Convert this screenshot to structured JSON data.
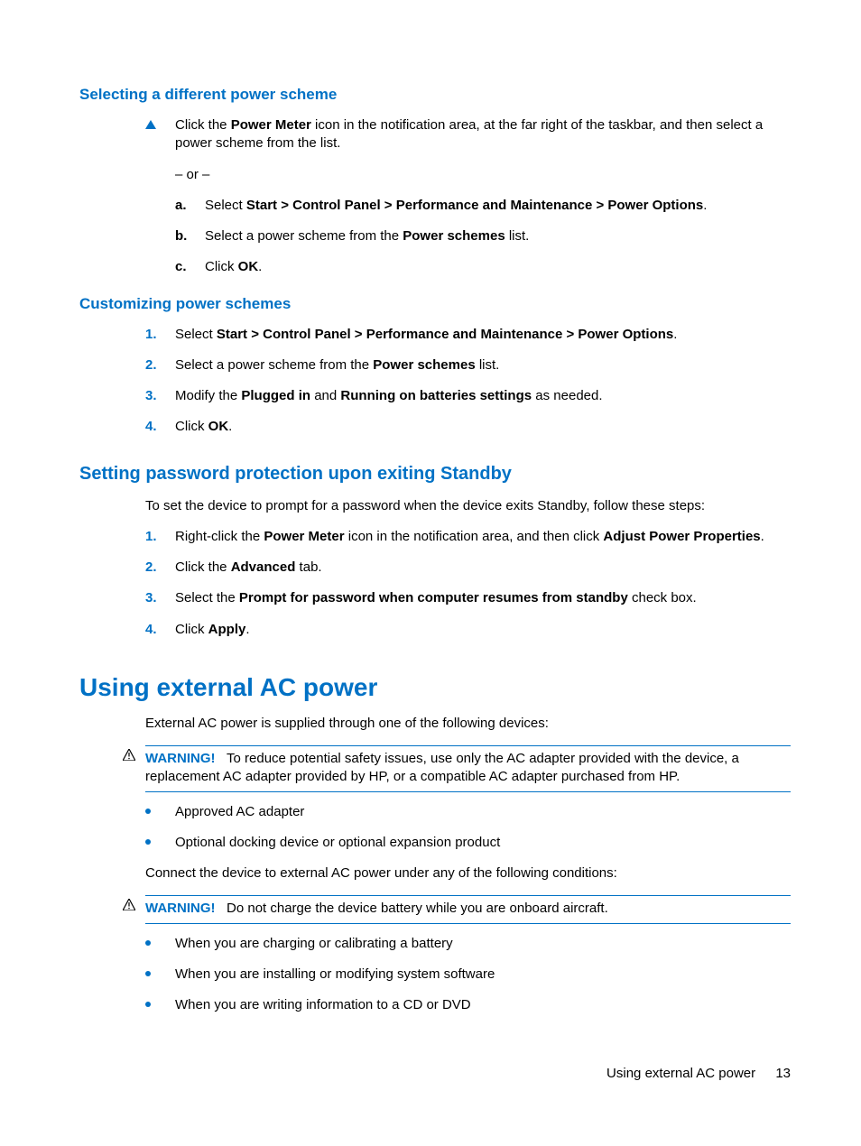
{
  "sec1": {
    "heading": "Selecting a different power scheme",
    "intro_pre": "Click the ",
    "intro_bold": "Power Meter",
    "intro_post": " icon in the notification area, at the far right of the taskbar, and then select a power scheme from the list.",
    "or": "– or –",
    "a_pre": "Select ",
    "a_bold": "Start > Control Panel > Performance and Maintenance > Power Options",
    "a_post": ".",
    "b_pre": "Select a power scheme from the ",
    "b_bold": "Power schemes",
    "b_post": " list.",
    "c_pre": "Click ",
    "c_bold": "OK",
    "c_post": "."
  },
  "sec2": {
    "heading": "Customizing power schemes",
    "s1_pre": "Select ",
    "s1_bold": "Start > Control Panel > Performance and Maintenance > Power Options",
    "s1_post": ".",
    "s2_pre": "Select a power scheme from the ",
    "s2_bold": "Power schemes",
    "s2_post": " list.",
    "s3_pre": "Modify the ",
    "s3_b1": "Plugged in",
    "s3_mid": " and ",
    "s3_b2": "Running on batteries settings",
    "s3_post": " as needed.",
    "s4_pre": "Click ",
    "s4_bold": "OK",
    "s4_post": "."
  },
  "sec3": {
    "heading": "Setting password protection upon exiting Standby",
    "intro": "To set the device to prompt for a password when the device exits Standby, follow these steps:",
    "s1_pre": "Right-click the ",
    "s1_b1": "Power Meter",
    "s1_mid": " icon in the notification area, and then click ",
    "s1_b2": "Adjust Power Properties",
    "s1_post": ".",
    "s2_pre": "Click the ",
    "s2_bold": "Advanced",
    "s2_post": " tab.",
    "s3_pre": "Select the ",
    "s3_bold": "Prompt for password when computer resumes from standby",
    "s3_post": " check box.",
    "s4_pre": "Click ",
    "s4_bold": "Apply",
    "s4_post": "."
  },
  "sec4": {
    "heading": "Using external AC power",
    "intro": "External AC power is supplied through one of the following devices:",
    "warn1_label": "WARNING!",
    "warn1_text": "To reduce potential safety issues, use only the AC adapter provided with the device, a replacement AC adapter provided by HP, or a compatible AC adapter purchased from HP.",
    "b1": "Approved AC adapter",
    "b2": "Optional docking device or optional expansion product",
    "mid": "Connect the device to external AC power under any of the following conditions:",
    "warn2_label": "WARNING!",
    "warn2_text": "Do not charge the device battery while you are onboard aircraft.",
    "c1": "When you are charging or calibrating a battery",
    "c2": "When you are installing or modifying system software",
    "c3": "When you are writing information to a CD or DVD"
  },
  "markers": {
    "a": "a.",
    "b": "b.",
    "c": "c.",
    "n1": "1.",
    "n2": "2.",
    "n3": "3.",
    "n4": "4."
  },
  "footer": {
    "text": "Using external AC power",
    "page": "13"
  }
}
